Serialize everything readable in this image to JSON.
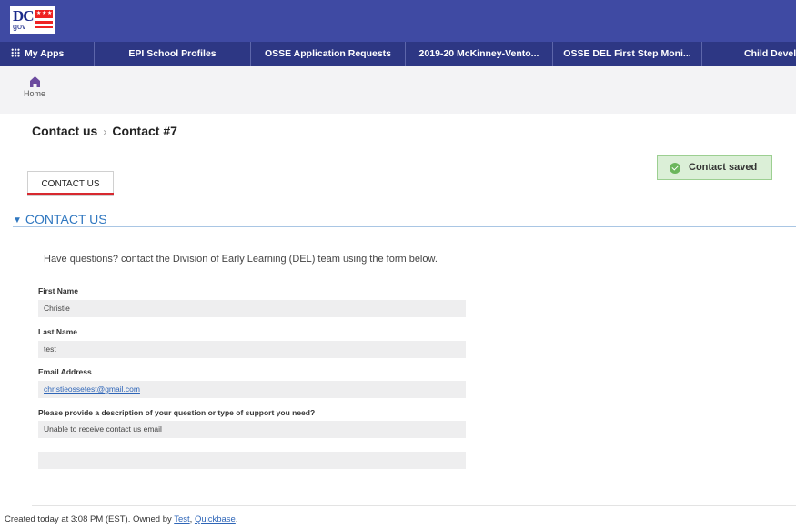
{
  "logo": {
    "text_dc": "DC",
    "text_gov": "gov"
  },
  "nav": {
    "apps_label": "My Apps",
    "items": [
      "EPI School Profiles",
      "OSSE Application Requests",
      "2019-20 McKinney-Vento...",
      "OSSE DEL First Step Moni...",
      "Child Devel"
    ]
  },
  "home": {
    "label": "Home"
  },
  "breadcrumb": {
    "parent": "Contact us",
    "separator": "›",
    "current": "Contact #7"
  },
  "toast": {
    "text": "Contact saved",
    "color": "#dbefd7"
  },
  "tab": {
    "label": "CONTACT US",
    "underline_color": "#d7282f"
  },
  "section": {
    "title": "CONTACT US",
    "intro": "Have questions? contact the Division of Early Learning (DEL) team using the form below."
  },
  "form": {
    "first_name": {
      "label": "First Name",
      "value": "Christie"
    },
    "last_name": {
      "label": "Last Name",
      "value": "test"
    },
    "email": {
      "label": "Email Address",
      "value": "christieossetest@gmail.com"
    },
    "description": {
      "label": "Please provide a description of your question or type of support you need?",
      "value": "Unable to receive contact us email"
    },
    "extra_value": ""
  },
  "footer": {
    "prefix": "Created today at  3:08 PM (EST). Owned by ",
    "owner_test": "Test",
    "owner_sep": ", ",
    "owner_qb": "Quickbase",
    "suffix": "."
  },
  "colors": {
    "topbar": "#3f4aa3",
    "navbar": "#2d3784",
    "accent_blue": "#2f77c0"
  }
}
